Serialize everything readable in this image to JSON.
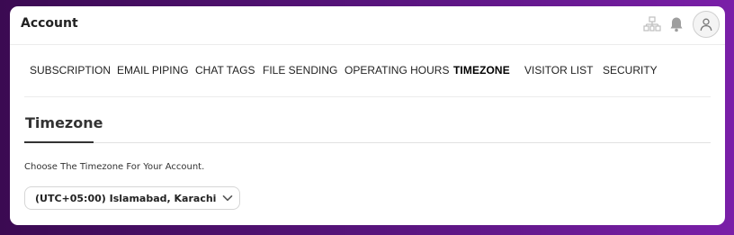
{
  "header": {
    "title": "Account",
    "icons": [
      "network-icon",
      "bell-icon",
      "user-avatar-icon"
    ]
  },
  "tabs": [
    {
      "label": "SUBSCRIPTION",
      "active": false
    },
    {
      "label": "EMAIL PIPING",
      "active": false
    },
    {
      "label": "CHAT TAGS",
      "active": false
    },
    {
      "label": "FILE SENDING",
      "active": false
    },
    {
      "label": "OPERATING HOURS",
      "active": false
    },
    {
      "label": "TIMEZONE",
      "active": true
    },
    {
      "label": "VISITOR LIST",
      "active": false
    },
    {
      "label": "SECURITY",
      "active": false
    }
  ],
  "section": {
    "title": "Timezone",
    "description": "Choose The Timezone For Your Account."
  },
  "timezone_select": {
    "selected": "(UTC+05:00) Islamabad, Karachi"
  },
  "colors": {
    "background_start": "#3b0a52",
    "background_end": "#7a1fa8",
    "card": "#ffffff",
    "text": "#222222"
  }
}
